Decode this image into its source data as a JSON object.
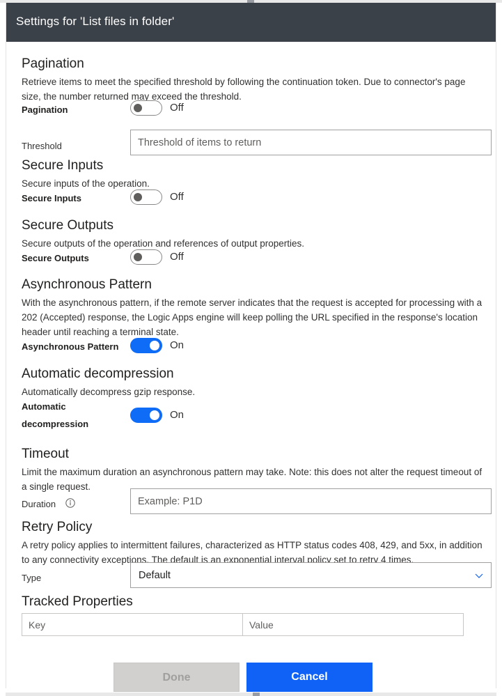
{
  "panel": {
    "title": "Settings for 'List files in folder'"
  },
  "sections": {
    "pagination": {
      "title": "Pagination",
      "description": "Retrieve items to meet the specified threshold by following the continuation token. Due to connector's page size, the number returned may exceed the threshold.",
      "toggle_label": "Pagination",
      "toggle_state": "Off",
      "threshold_label": "Threshold",
      "threshold_placeholder": "Threshold of items to return",
      "threshold_value": ""
    },
    "secure_inputs": {
      "title": "Secure Inputs",
      "description": "Secure inputs of the operation.",
      "toggle_label": "Secure Inputs",
      "toggle_state": "Off"
    },
    "secure_outputs": {
      "title": "Secure Outputs",
      "description": "Secure outputs of the operation and references of output properties.",
      "toggle_label": "Secure Outputs",
      "toggle_state": "Off"
    },
    "async_pattern": {
      "title": "Asynchronous Pattern",
      "description": "With the asynchronous pattern, if the remote server indicates that the request is accepted for processing with a 202 (Accepted) response, the Logic Apps engine will keep polling the URL specified in the response's location header until reaching a terminal state.",
      "toggle_label": "Asynchronous Pattern",
      "toggle_state": "On"
    },
    "automatic_decompression": {
      "title": "Automatic decompression",
      "description": "Automatically decompress gzip response.",
      "toggle_label_line1": "Automatic",
      "toggle_label_line2": "decompression",
      "toggle_state": "On"
    },
    "timeout": {
      "title": "Timeout",
      "description": "Limit the maximum duration an asynchronous pattern may take. Note: this does not alter the request timeout of a single request.",
      "duration_label": "Duration",
      "duration_placeholder": "Example: P1D",
      "duration_value": ""
    },
    "retry_policy": {
      "title": "Retry Policy",
      "description": "A retry policy applies to intermittent failures, characterized as HTTP status codes 408, 429, and 5xx, in addition to any connectivity exceptions. The default is an exponential interval policy set to retry 4 times.",
      "type_label": "Type",
      "type_value": "Default"
    },
    "tracked_properties": {
      "title": "Tracked Properties",
      "key_placeholder": "Key",
      "key_value": "",
      "value_placeholder": "Value",
      "value_value": ""
    }
  },
  "footer": {
    "done_label": "Done",
    "cancel_label": "Cancel"
  },
  "colors": {
    "header_bg": "#3b4149",
    "accent_blue": "#0f62f5",
    "toggle_on": "#0f6cf7",
    "disabled_bg": "#d2d0ce"
  }
}
